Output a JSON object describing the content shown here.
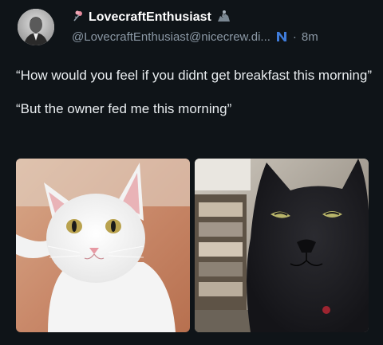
{
  "author": {
    "display_name": "LovecraftEnthusiast",
    "handle": "@LovecraftEnthusiast@nicecrew.di...",
    "time": "8m",
    "separator": "·"
  },
  "post": {
    "lines": [
      "“How would you feel if you didnt get breakfast this morning”",
      "“But the owner fed me this morning”"
    ]
  },
  "media": {
    "images": [
      {
        "subject": "white-cat"
      },
      {
        "subject": "black-cat"
      }
    ]
  },
  "icons": {
    "name_prefix": "flower-icon",
    "name_suffix": "rider-icon",
    "instance": "n-logo-icon"
  },
  "colors": {
    "background": "#0f1418",
    "name": "#ffffff",
    "muted": "#8b98a5",
    "instance_icon": "#3f7bd8"
  }
}
